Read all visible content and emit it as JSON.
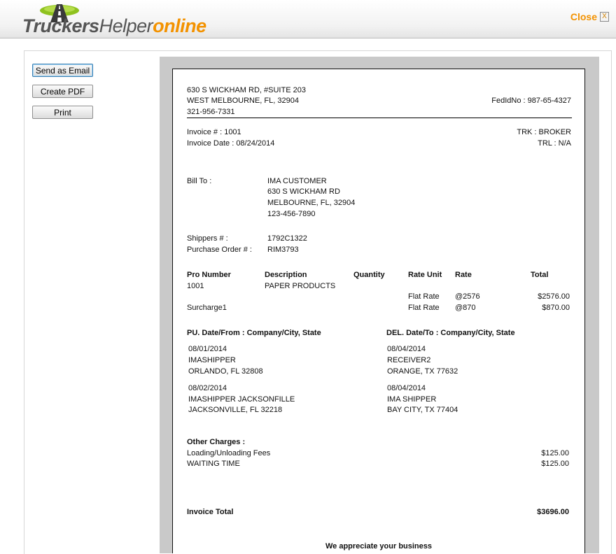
{
  "header": {
    "logo": {
      "part1": "Truckers",
      "part2": "Helper",
      "part3": "online"
    },
    "close_label": "Close",
    "close_icon_glyph": "X"
  },
  "actions": {
    "send_email": "Send as Email",
    "create_pdf": "Create PDF",
    "print": "Print"
  },
  "invoice": {
    "company": {
      "address1": "630 S WICKHAM RD, #SUITE 203",
      "address2": "WEST MELBOURNE, FL, 32904",
      "phone": "321-956-7331",
      "fedid": "FedIdNo : 987-65-4327"
    },
    "invoice_no": "Invoice # : 1001",
    "invoice_date": "Invoice Date : 08/24/2014",
    "trk": "TRK : BROKER",
    "trl": "TRL : N/A",
    "bill_to_label": "Bill To :",
    "bill_to": {
      "name": "IMA CUSTOMER",
      "address1": "630 S WICKHAM RD",
      "address2": "MELBOURNE, FL, 32904",
      "phone": "123-456-7890"
    },
    "shippers_label": "Shippers # :",
    "shippers_value": "1792C1322",
    "po_label": "Purchase Order # :",
    "po_value": "RIM3793",
    "table": {
      "headers": {
        "pro": "Pro Number",
        "desc": "Description",
        "qty": "Quantity",
        "rate_unit": "Rate Unit",
        "rate": "Rate",
        "total": "Total"
      },
      "row1": {
        "pro": "1001",
        "desc": "PAPER PRODUCTS",
        "rate_unit": "Flat Rate",
        "rate": "@2576",
        "total": "$2576.00"
      },
      "row2": {
        "pro": "Surcharge1",
        "rate_unit": "Flat Rate",
        "rate": "@870",
        "total": "$870.00"
      }
    },
    "stops": {
      "pu_header": "PU. Date/From : Company/City, State",
      "del_header": "DEL. Date/To : Company/City, State",
      "pu": [
        {
          "date": "08/01/2014",
          "company": "IMASHIPPER",
          "city": "ORLANDO, FL 32808"
        },
        {
          "date": "08/02/2014",
          "company": "IMASHIPPER JACKSONFILLE",
          "city": "JACKSONVILLE, FL 32218"
        }
      ],
      "del": [
        {
          "date": "08/04/2014",
          "company": "RECEIVER2",
          "city": "ORANGE, TX 77632"
        },
        {
          "date": "08/04/2014",
          "company": "IMA SHIPPER",
          "city": "BAY CITY, TX 77404"
        }
      ]
    },
    "other_charges_label": "Other Charges :",
    "other_charges": [
      {
        "name": "Loading/Unloading Fees",
        "amount": "$125.00"
      },
      {
        "name": "WAITING TIME",
        "amount": "$125.00"
      }
    ],
    "total_label": "Invoice Total",
    "total_value": "$3696.00",
    "footer": "We appreciate your business"
  },
  "colors": {
    "brand_orange": "#f39200",
    "doc_bg": "#c9c9c9"
  }
}
